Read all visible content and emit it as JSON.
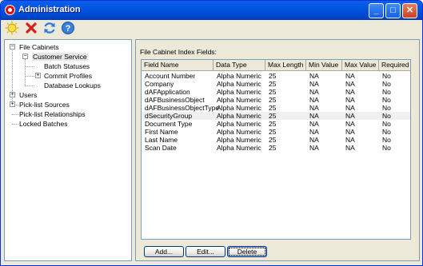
{
  "window": {
    "title": "Administration"
  },
  "tree": {
    "file_cabinets": "File Cabinets",
    "customer_service": "Customer Service",
    "batch_statuses": "Batch Statuses",
    "commit_profiles": "Commit Profiles",
    "database_lookups": "Database Lookups",
    "users": "Users",
    "pick_list_sources": "Pick-list Sources",
    "pick_list_relationships": "Pick-list Relationships",
    "locked_batches": "Locked Batches"
  },
  "panel": {
    "label": "File Cabinet Index Fields:"
  },
  "table": {
    "columns": [
      "Field Name",
      "Data Type",
      "Max Length",
      "Min Value",
      "Max Value",
      "Required"
    ],
    "rows": [
      [
        "Account Number",
        "Alpha Numeric",
        "25",
        "NA",
        "NA",
        "No"
      ],
      [
        "Company",
        "Alpha Numeric",
        "25",
        "NA",
        "NA",
        "No"
      ],
      [
        "dAFApplication",
        "Alpha Numeric",
        "25",
        "NA",
        "NA",
        "No"
      ],
      [
        "dAFBusinessObject",
        "Alpha Numeric",
        "25",
        "NA",
        "NA",
        "No"
      ],
      [
        "dAFBusinessObjectType",
        "Alpha Numeric",
        "25",
        "NA",
        "NA",
        "No"
      ],
      [
        "dSecurityGroup",
        "Alpha Numeric",
        "25",
        "NA",
        "NA",
        "No"
      ],
      [
        "Document Type",
        "Alpha Numeric",
        "25",
        "NA",
        "NA",
        "No"
      ],
      [
        "First Name",
        "Alpha Numeric",
        "25",
        "NA",
        "NA",
        "No"
      ],
      [
        "Last Name",
        "Alpha Numeric",
        "25",
        "NA",
        "NA",
        "No"
      ],
      [
        "Scan Date",
        "Alpha Numeric",
        "25",
        "NA",
        "NA",
        "No"
      ]
    ]
  },
  "buttons": {
    "add": "Add...",
    "edit": "Edit...",
    "delete": "Delete"
  },
  "toolbar": {
    "icons": [
      "new-icon",
      "delete-icon",
      "refresh-icon",
      "help-icon"
    ]
  },
  "title_buttons": {
    "minimize": "_",
    "maximize": "□",
    "close": "✕"
  }
}
